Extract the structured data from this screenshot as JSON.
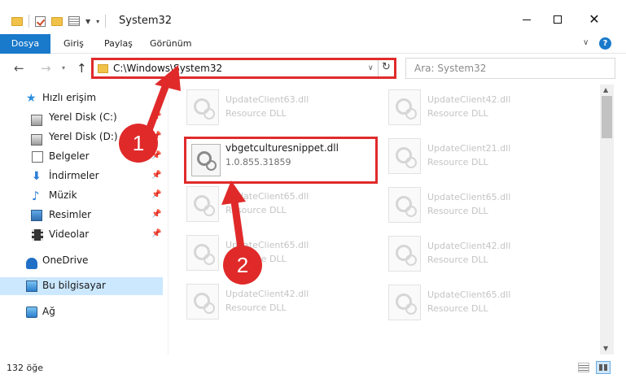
{
  "window": {
    "title": "System32",
    "minimize_icon": "minimize-icon",
    "maximize_icon": "maximize-icon",
    "close_glyph": "✕"
  },
  "ribbon": {
    "tabs": [
      "Dosya",
      "Giriş",
      "Paylaş",
      "Görünüm"
    ],
    "accent_color": "#1979ca",
    "help_glyph": "?"
  },
  "address": {
    "path": "C:\\Windows\\System32",
    "search_placeholder": "Ara: System32"
  },
  "nav": {
    "items": [
      {
        "label": "Hızlı erişim",
        "icon": "star-icon"
      },
      {
        "label": "Yerel Disk (C:)",
        "icon": "disk-icon",
        "pinned": true
      },
      {
        "label": "Yerel Disk (D:)",
        "icon": "disk-icon",
        "pinned": true
      },
      {
        "label": "Belgeler",
        "icon": "document-icon",
        "pinned": true
      },
      {
        "label": "İndirmeler",
        "icon": "download-icon",
        "pinned": true
      },
      {
        "label": "Müzik",
        "icon": "music-icon",
        "pinned": true
      },
      {
        "label": "Resimler",
        "icon": "pictures-icon",
        "pinned": true
      },
      {
        "label": "Videolar",
        "icon": "video-icon",
        "pinned": true
      },
      {
        "label": "OneDrive",
        "icon": "cloud-icon"
      },
      {
        "label": "Bu bilgisayar",
        "icon": "computer-icon",
        "selected": true
      },
      {
        "label": "Ağ",
        "icon": "network-icon"
      }
    ],
    "selected_color": "#cce8ff"
  },
  "files": {
    "left": [
      {
        "name": "UpdateClient63.dll",
        "sub": "Resource DLL"
      },
      {
        "name": "UpdateClient65.dll",
        "sub": "Resource DLL"
      },
      {
        "name": "UpdateClient65.dll",
        "sub": "Resource DLL"
      },
      {
        "name": "UpdateClient42.dll",
        "sub": "Resource DLL"
      }
    ],
    "right": [
      {
        "name": "UpdateClient42.dll",
        "sub": "Resource DLL"
      },
      {
        "name": "UpdateClient21.dll",
        "sub": "Resource DLL"
      },
      {
        "name": "UpdateClient65.dll",
        "sub": "Resource DLL"
      },
      {
        "name": "UpdateClient42.dll",
        "sub": "Resource DLL"
      },
      {
        "name": "UpdateClient65.dll",
        "sub": "Resource DLL"
      }
    ],
    "highlighted": {
      "name": "vbgetculturesnippet.dll",
      "sub": "1.0.855.31859"
    }
  },
  "annotations": {
    "marker_1": "1",
    "marker_2": "2",
    "color": "#e02a2a"
  },
  "status": {
    "item_count": "132 öğe"
  }
}
